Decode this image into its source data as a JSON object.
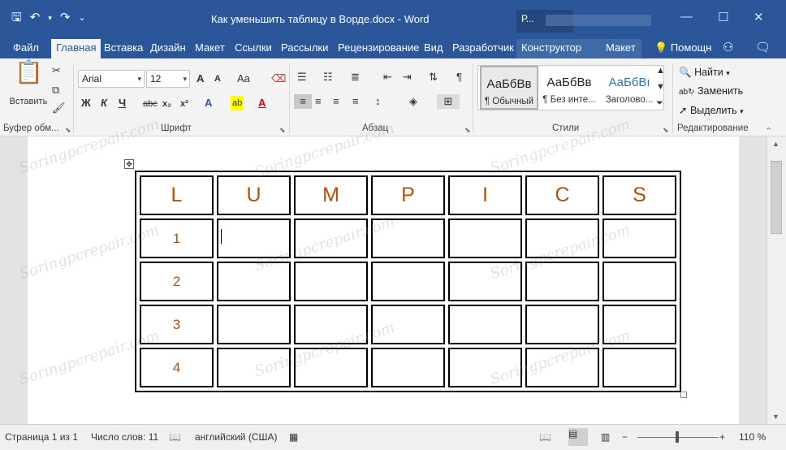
{
  "titlebar": {
    "title": "Как уменьшить таблицу в Ворде.docx - Word",
    "context_label": "Р...",
    "qat": {
      "save_icon": "save-icon",
      "undo_icon": "undo-icon",
      "redo_icon": "redo-icon",
      "customize_icon": "customize-qat-icon"
    },
    "window_controls": [
      "minimize",
      "maximize",
      "close"
    ]
  },
  "tabs": [
    "Файл",
    "Главная",
    "Вставка",
    "Дизайн",
    "Макет",
    "Ссылки",
    "Рассылки",
    "Рецензирование",
    "Вид",
    "Разработчик",
    "Конструктор",
    "Макет"
  ],
  "help": {
    "label": "Помощн"
  },
  "ribbon": {
    "clipboard": {
      "paste_label": "Вставить",
      "group_label": "Буфер обм..."
    },
    "font": {
      "name": "Arial",
      "size": "12",
      "group_label": "Шрифт",
      "grow_label": "A",
      "shrink_label": "A",
      "case_label": "Aa",
      "bold": "Ж",
      "italic": "К",
      "underline": "Ч",
      "strike": "abc",
      "sub": "x₂",
      "sup": "x²",
      "effects": "A",
      "highlight": "ab",
      "color": "A"
    },
    "paragraph": {
      "group_label": "Абзац",
      "pilcrow": "¶"
    },
    "styles": {
      "group_label": "Стили",
      "items": [
        {
          "sample": "АаБбВв",
          "name": "¶ Обычный"
        },
        {
          "sample": "АаБбВв",
          "name": "¶ Без инте..."
        },
        {
          "sample": "АаБбВı",
          "name": "Заголово..."
        }
      ]
    },
    "editing": {
      "group_label": "Редактирование",
      "find": "Найти",
      "replace": "Заменить",
      "select": "Выделить"
    }
  },
  "table": {
    "header": [
      "L",
      "U",
      "M",
      "P",
      "I",
      "C",
      "S"
    ],
    "row_numbers": [
      "1",
      "2",
      "3",
      "4"
    ]
  },
  "watermark": "Soringpcrepair.com",
  "status": {
    "page": "Страница 1 из 1",
    "words": "Число слов: 11",
    "language": "английский (США)",
    "zoom": "110 %",
    "zoom_minus": "−",
    "zoom_plus": "+"
  },
  "colors": {
    "accent": "#2b579a",
    "table_text": "#b3500e"
  }
}
